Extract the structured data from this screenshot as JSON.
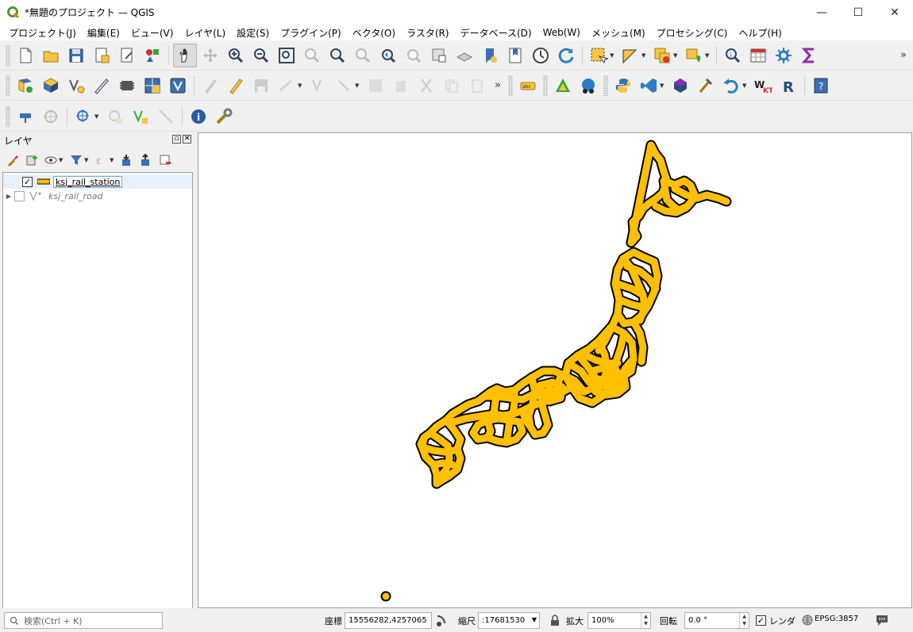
{
  "window": {
    "title": "*無題のプロジェクト — QGIS",
    "minimize": "—",
    "maximize": "☐",
    "close": "✕"
  },
  "menu": [
    "プロジェクト(J)",
    "編集(E)",
    "ビュー(V)",
    "レイヤ(L)",
    "設定(S)",
    "プラグイン(P)",
    "ベクタ(O)",
    "ラスタ(R)",
    "データベース(D)",
    "Web(W)",
    "メッシュ(M)",
    "プロセシング(C)",
    "ヘルプ(H)"
  ],
  "toolbar_more": "»",
  "layers_panel": {
    "title": "レイヤ",
    "float_btn": "▫",
    "close_btn": "✕",
    "layers": [
      {
        "name": "ksj_rail_station",
        "checked": true,
        "check_mark": "✓",
        "icon": "point-layer-icon",
        "selected": true
      },
      {
        "name": "ksj_rail_road",
        "checked": false,
        "check_mark": "",
        "icon": "line-layer-icon",
        "selected": false,
        "expander": "▶"
      }
    ]
  },
  "map": {
    "fill_color": "#ffc000",
    "stroke_color": "#000000"
  },
  "status": {
    "search_placeholder": "検索(Ctrl + K)",
    "coord_label": "座標",
    "coord_value": "15556282,4257065",
    "scale_label": "縮尺",
    "scale_value": ":17681530",
    "magnifier_label": "拡大",
    "magnifier_value": "100%",
    "rotation_label": "回転",
    "rotation_value": "0.0 °",
    "render_label": "レンダ",
    "render_checked": "✓",
    "crs": "EPSG:3857"
  }
}
